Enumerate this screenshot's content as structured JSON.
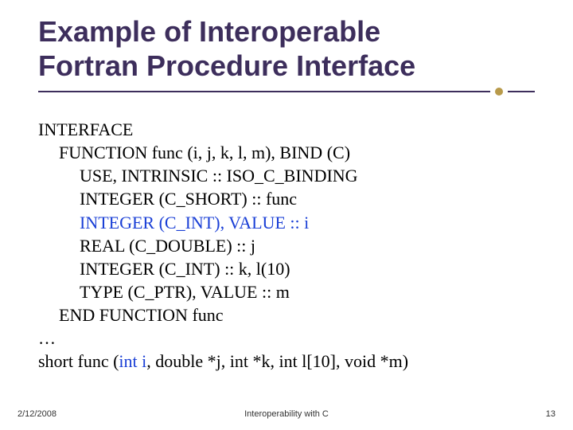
{
  "title": {
    "line1": "Example of Interoperable",
    "line2": "Fortran Procedure Interface"
  },
  "code": {
    "l1": "INTERFACE",
    "l2": "FUNCTION func (i, j, k, l, m), BIND (C)",
    "l3": "USE, INTRINSIC :: ISO_C_BINDING",
    "l4": "INTEGER (C_SHORT) :: func",
    "l5_hl": "INTEGER (C_INT), VALUE :: i",
    "l6": "REAL (C_DOUBLE) :: j",
    "l7": "INTEGER (C_INT) :: k, l(10)",
    "l8": "TYPE (C_PTR), VALUE :: m",
    "l9": "END FUNCTION func",
    "l10": "…",
    "l11_pre": "short func (",
    "l11_hl": "int i",
    "l11_post": ", double *j, int *k, int l[10], void *m)"
  },
  "footer": {
    "date": "2/12/2008",
    "center": "Interoperability with C",
    "page": "13"
  }
}
